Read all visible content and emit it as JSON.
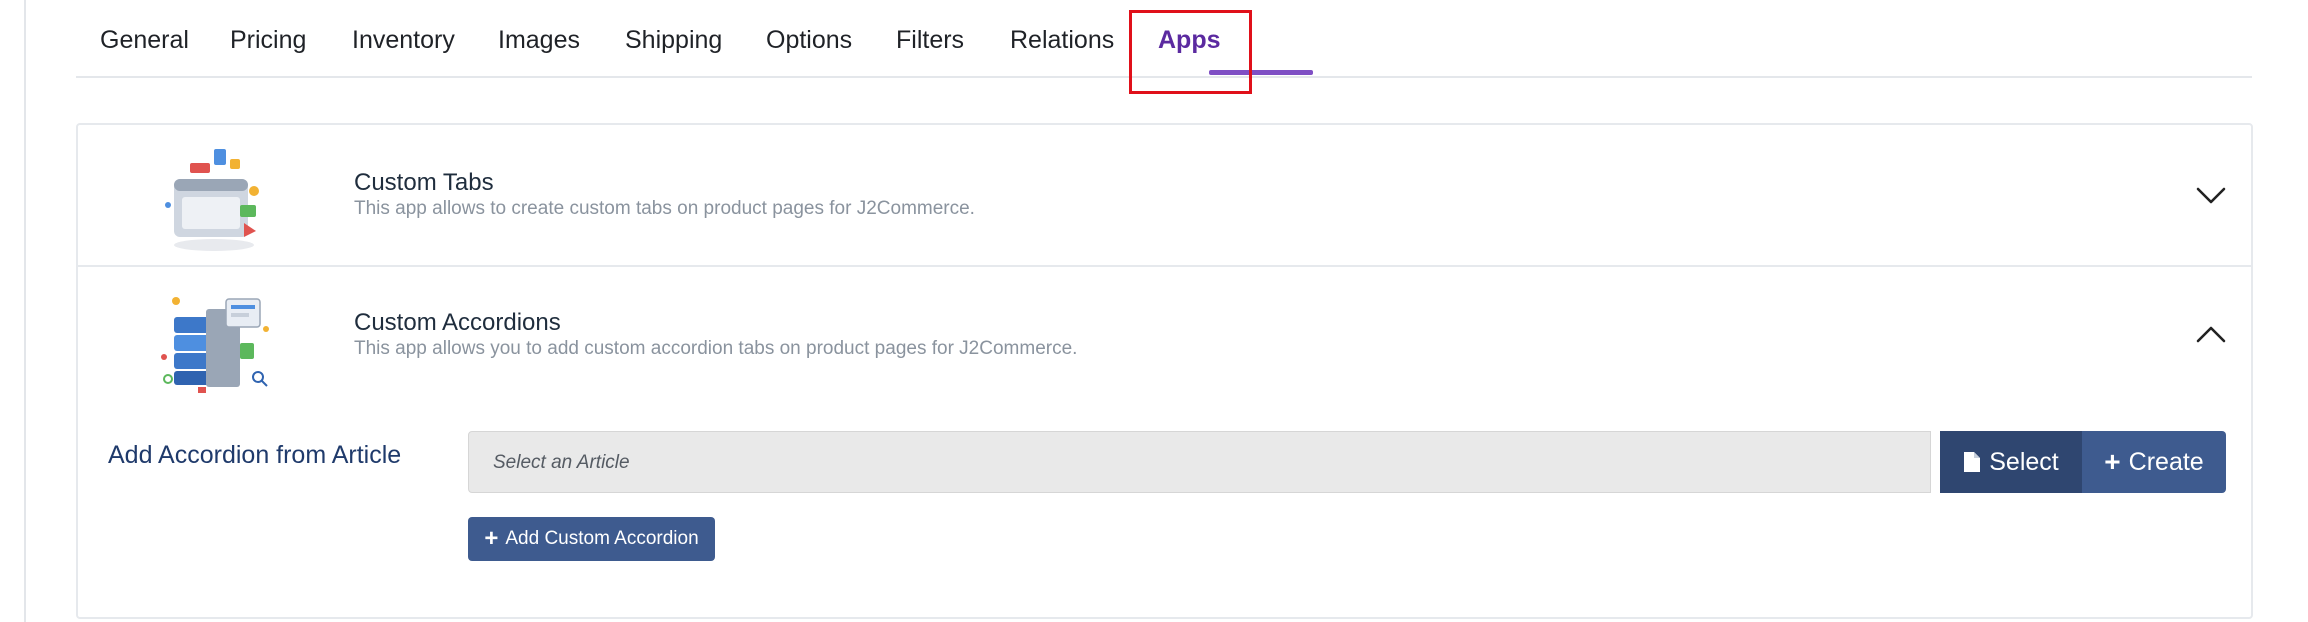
{
  "tabs": [
    {
      "label": "General"
    },
    {
      "label": "Pricing"
    },
    {
      "label": "Inventory"
    },
    {
      "label": "Images"
    },
    {
      "label": "Shipping"
    },
    {
      "label": "Options"
    },
    {
      "label": "Filters"
    },
    {
      "label": "Relations"
    },
    {
      "label": "Apps",
      "active": true
    }
  ],
  "apps": [
    {
      "title": "Custom Tabs",
      "description": "This app allows to create custom tabs on product pages for J2Commerce.",
      "icon": "custom-tabs-app-icon",
      "expanded": false
    },
    {
      "title": "Custom Accordions",
      "description": "This app allows you to add custom accordion tabs on product pages for J2Commerce.",
      "icon": "custom-accordions-app-icon",
      "expanded": true
    }
  ],
  "accordion_form": {
    "label": "Add Accordion from Article",
    "article_placeholder": "Select an Article",
    "select_label": "Select",
    "create_label": "Create",
    "add_label": "Add Custom Accordion"
  },
  "colors": {
    "active_tab": "#5b2aa0",
    "primary_button": "#3e5b8f",
    "select_button": "#2f4670",
    "highlight": "#e0101a"
  }
}
